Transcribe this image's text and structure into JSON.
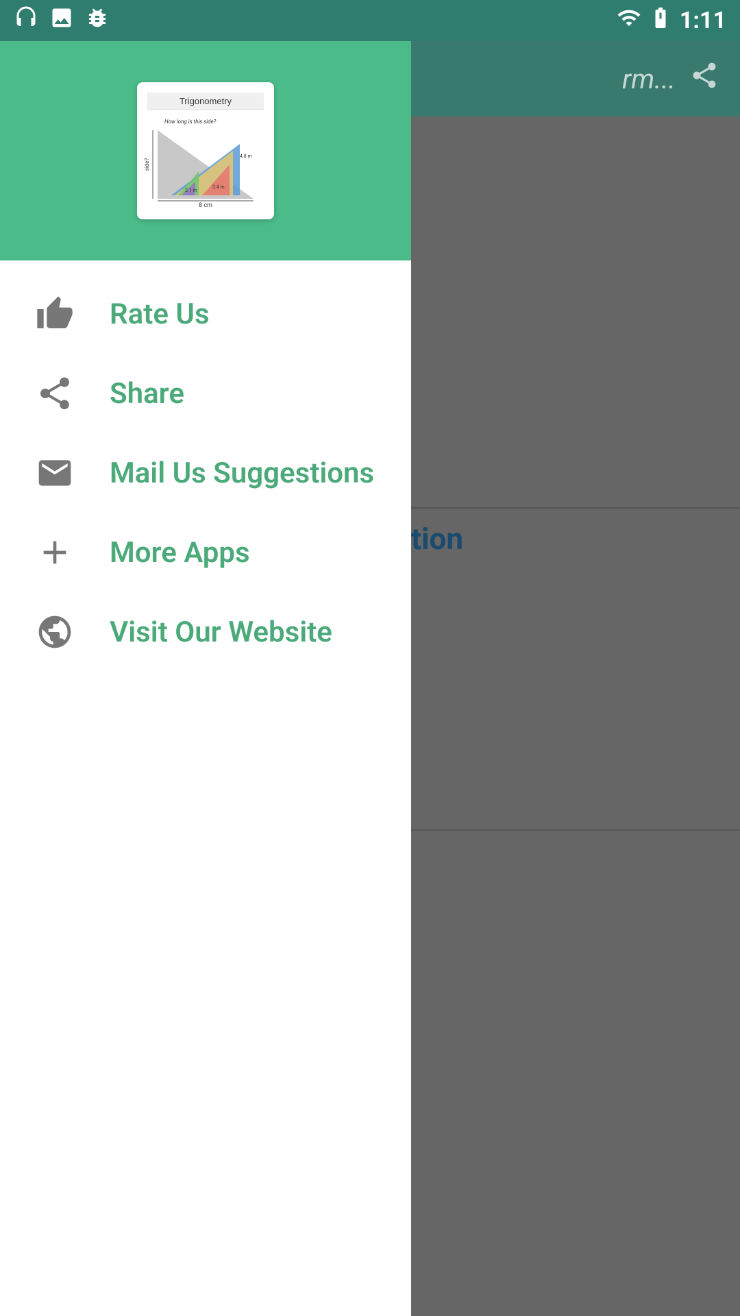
{
  "statusBar": {
    "time": "1:11",
    "leftIcons": [
      "headphone-icon",
      "image-icon",
      "bug-icon"
    ],
    "rightIcons": [
      "signal-icon",
      "battery-icon"
    ]
  },
  "drawer": {
    "header": {
      "appName": "Trigonometry"
    },
    "menuItems": [
      {
        "id": "rate-us",
        "label": "Rate Us",
        "icon": "thumbs-up-icon"
      },
      {
        "id": "share",
        "label": "Share",
        "icon": "share-icon"
      },
      {
        "id": "mail-us",
        "label": "Mail Us Suggestions",
        "icon": "mail-icon"
      },
      {
        "id": "more-apps",
        "label": "More Apps",
        "icon": "plus-icon"
      },
      {
        "id": "visit-website",
        "label": "Visit Our Website",
        "icon": "globe-icon"
      }
    ]
  },
  "background": {
    "toolbarText": "rm...",
    "sectionLabel": "tion"
  }
}
